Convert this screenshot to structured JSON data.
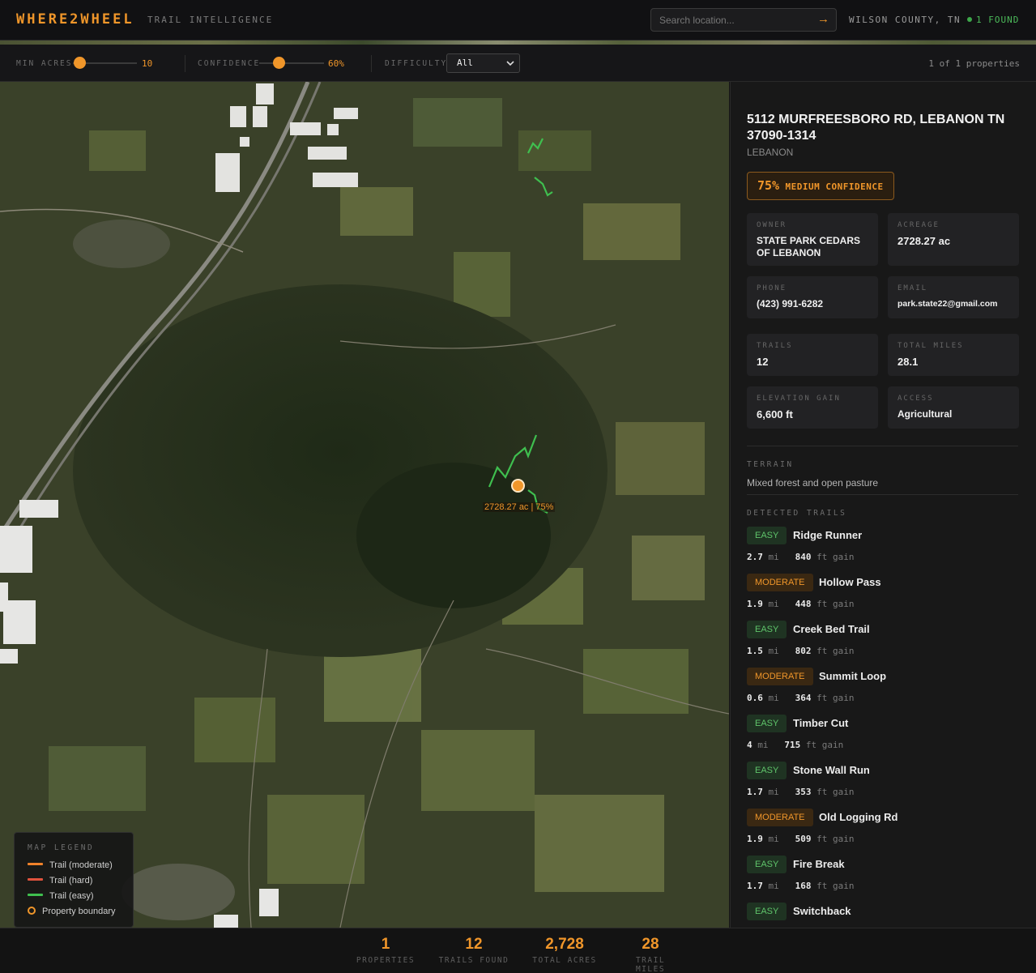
{
  "header": {
    "brand": "WHERE2WHEEL",
    "tagline": "TRAIL INTELLIGENCE",
    "search_placeholder": "Search location...",
    "search_button": "→",
    "county": "WILSON COUNTY, TN",
    "found": "1 FOUND"
  },
  "filters": {
    "min_acres_label": "MIN ACRES",
    "min_acres_value": "10",
    "min_acres_level": 0.1,
    "confidence_label": "CONFIDENCE",
    "confidence_value": "60%",
    "confidence_level": 0.3,
    "difficulty_label": "DIFFICULTY",
    "difficulty_selected": "All",
    "count": "1 of 1 properties"
  },
  "map": {
    "marker_label": "2728.27 ac | 75%",
    "legend": {
      "title": "MAP LEGEND",
      "items": [
        {
          "label": "Trail (moderate)",
          "color": "#f0822a"
        },
        {
          "label": "Trail (hard)",
          "color": "#e0533d"
        },
        {
          "label": "Trail (easy)",
          "color": "#3fbf4f"
        },
        {
          "label": "Property boundary",
          "color": "#f0962a"
        }
      ]
    }
  },
  "property": {
    "address": "5112 MURFREESBORO RD, LEBANON TN 37090-1314",
    "city": "LEBANON",
    "confidence_pct": "75%",
    "confidence_label": "MEDIUM CONFIDENCE",
    "fields": {
      "owner": {
        "label": "OWNER",
        "value": "STATE PARK CEDARS OF LEBANON"
      },
      "acreage": {
        "label": "ACREAGE",
        "value": "2728.27 ac"
      },
      "phone": {
        "label": "PHONE",
        "value": "(423) 991-6282"
      },
      "email": {
        "label": "EMAIL",
        "value": "park.state22@gmail.com"
      },
      "trails": {
        "label": "TRAILS",
        "value": "12"
      },
      "total_miles": {
        "label": "TOTAL MILES",
        "value": "28.1"
      },
      "elevation": {
        "label": "ELEVATION GAIN",
        "value": "6,600 ft"
      },
      "access": {
        "label": "ACCESS",
        "value": "Agricultural"
      }
    },
    "terrain_label": "TERRAIN",
    "terrain": "Mixed forest and open pasture",
    "trails_label": "DETECTED TRAILS",
    "trails": [
      {
        "difficulty": "EASY",
        "name": "Ridge Runner",
        "miles": "2.7",
        "gain": "840"
      },
      {
        "difficulty": "MODERATE",
        "name": "Hollow Pass",
        "miles": "1.9",
        "gain": "448"
      },
      {
        "difficulty": "EASY",
        "name": "Creek Bed Trail",
        "miles": "1.5",
        "gain": "802"
      },
      {
        "difficulty": "MODERATE",
        "name": "Summit Loop",
        "miles": "0.6",
        "gain": "364"
      },
      {
        "difficulty": "EASY",
        "name": "Timber Cut",
        "miles": "4",
        "gain": "715"
      },
      {
        "difficulty": "EASY",
        "name": "Stone Wall Run",
        "miles": "1.7",
        "gain": "353"
      },
      {
        "difficulty": "MODERATE",
        "name": "Old Logging Rd",
        "miles": "1.9",
        "gain": "509"
      },
      {
        "difficulty": "EASY",
        "name": "Fire Break",
        "miles": "1.7",
        "gain": "168"
      },
      {
        "difficulty": "EASY",
        "name": "Switchback",
        "miles": "",
        "gain": ""
      }
    ],
    "units": {
      "mi": "mi",
      "gain": "ft gain"
    }
  },
  "footer": {
    "stats": [
      {
        "value": "1",
        "label": "PROPERTIES"
      },
      {
        "value": "12",
        "label": "TRAILS FOUND"
      },
      {
        "value": "2,728",
        "label": "TOTAL ACRES"
      },
      {
        "value": "28",
        "label": "TRAIL MILES"
      }
    ]
  }
}
